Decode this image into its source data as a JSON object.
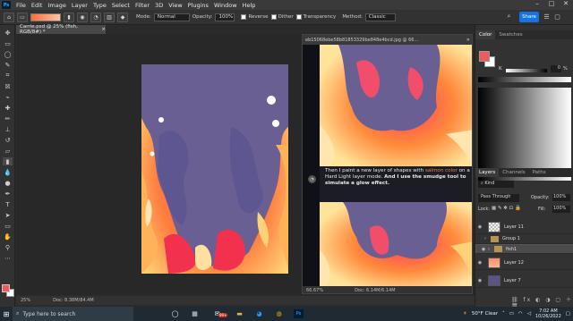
{
  "menu": {
    "app_icon": "Ps",
    "items": [
      "File",
      "Edit",
      "Image",
      "Layer",
      "Type",
      "Select",
      "Filter",
      "3D",
      "View",
      "Plugins",
      "Window",
      "Help"
    ]
  },
  "options_bar": {
    "mode_label": "Mode:",
    "mode_value": "Normal",
    "opacity_label": "Opacity:",
    "opacity_value": "100%",
    "reverse": "Reverse",
    "dither": "Dither",
    "transparency": "Transparency",
    "method_label": "Method:",
    "method_value": "Classic",
    "share_label": "Share"
  },
  "document": {
    "tab_title": "Carrie.psd @ 25% (fish, RGB/8#) *",
    "zoom": "25%",
    "doc_info": "Doc: 8.38M/84.4M"
  },
  "reference_window": {
    "title": "eb15068ebe58b81853329be848e4bcd.jpg @ 66...",
    "zoom": "66.67%",
    "doc_info": "Doc: 6.14M/6.14M",
    "caption_parts": [
      "Then I paint a new layer of shapes with ",
      "salmon color",
      " on a Hard Light layer mode. ",
      "And I use the smudge tool to simulate a glow effect."
    ]
  },
  "color_panel": {
    "tabs": [
      "Color",
      "Swatches"
    ],
    "k_label": "K",
    "k_value": "0",
    "k_unit": "%",
    "foreground": "#ef5a5a",
    "background": "#ffffff"
  },
  "layers_panel": {
    "tabs": [
      "Layers",
      "Channels",
      "Paths"
    ],
    "filter_value": "Kind",
    "blend_mode": "Pass Through",
    "opacity_label": "Opacity:",
    "opacity_value": "100%",
    "lock_label": "Lock:",
    "fill_label": "Fill:",
    "fill_value": "100%",
    "layers": [
      {
        "name": "Layer 11",
        "visible": true,
        "kind": "transparent"
      },
      {
        "name": "Group 1",
        "visible": false,
        "kind": "group"
      },
      {
        "name": "fish1",
        "visible": true,
        "kind": "group",
        "selected": true
      },
      {
        "name": "Layer 12",
        "visible": true,
        "kind": "salmon"
      },
      {
        "name": "Layer 7",
        "visible": true,
        "kind": "navy"
      }
    ]
  },
  "taskbar": {
    "search_placeholder": "Type here to search",
    "weather": "50°F  Clear",
    "time": "7:02 AM",
    "date": "10/26/2022",
    "badge": "99+"
  },
  "colors": {
    "accent": "#1473e6",
    "flame_orange": "#ff8a3c",
    "flame_red": "#f2314f",
    "flame_yellow": "#ffd278",
    "smoke_purple": "#6a5f93"
  }
}
